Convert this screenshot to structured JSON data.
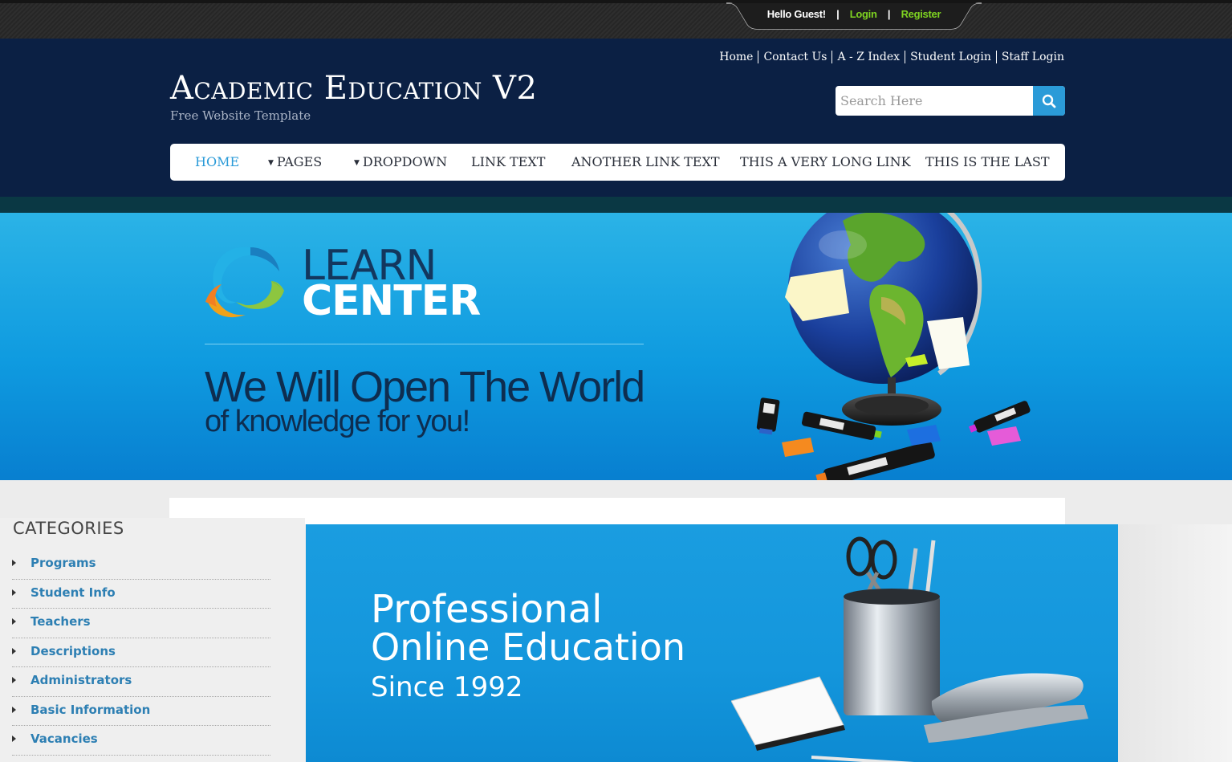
{
  "topbar": {
    "greeting": "Hello Guest!",
    "separator": "|",
    "login": "Login",
    "register": "Register"
  },
  "header": {
    "links": [
      "Home",
      "Contact Us",
      "A - Z Index",
      "Student Login",
      "Staff Login"
    ],
    "title": "Academic Education V2",
    "subtitle": "Free Website Template",
    "search": {
      "placeholder": "Search Here",
      "icon": "search-icon"
    }
  },
  "nav": {
    "items": [
      {
        "label": "HOME",
        "active": true
      },
      {
        "label": "PAGES",
        "dropdown": true
      },
      {
        "label": "DROPDOWN",
        "dropdown": true
      },
      {
        "label": "LINK TEXT"
      },
      {
        "label": "ANOTHER LINK TEXT"
      },
      {
        "label": "THIS A VERY LONG LINK"
      },
      {
        "label": "THIS IS THE LAST"
      }
    ]
  },
  "banner": {
    "brand_line1": "LEARN",
    "brand_line2": "CENTER",
    "slogan_line1": "We Will Open The World",
    "slogan_line2": "of knowledge for you!"
  },
  "sidebar": {
    "heading": "CATEGORIES",
    "items": [
      "Programs",
      "Student Info",
      "Teachers",
      "Descriptions",
      "Administrators",
      "Basic Information",
      "Vacancies"
    ]
  },
  "feature": {
    "line1": "Professional",
    "line2": "Online Education",
    "line3": "Since 1992"
  },
  "colors": {
    "header_bg": "#0b2044",
    "accent_blue": "#2b9bd8",
    "topbar_link": "#7ed321",
    "category_link": "#2d7fb3"
  }
}
